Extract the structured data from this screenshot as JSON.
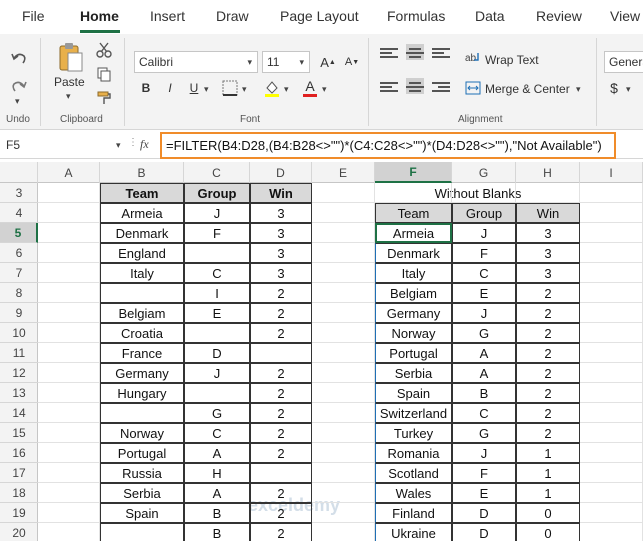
{
  "menu": {
    "tabs": [
      "File",
      "Home",
      "Insert",
      "Draw",
      "Page Layout",
      "Formulas",
      "Data",
      "Review",
      "View"
    ],
    "active": "Home"
  },
  "ribbon": {
    "paste_label": "Paste",
    "groups": {
      "undo": "Undo",
      "clipboard": "Clipboard",
      "font": "Font",
      "alignment": "Alignment"
    },
    "font_name": "Calibri",
    "font_size": "11",
    "bold": "B",
    "italic": "I",
    "underline": "U",
    "font_color_letter": "A",
    "wrap_text": "Wrap Text",
    "merge_center": "Merge & Center",
    "number_format": "Genera",
    "currency": "$",
    "accent_color": "#1e7145",
    "highlight_color": "#f08c2a"
  },
  "formula_bar": {
    "name_box": "F5",
    "fx": "fx",
    "formula": "=FILTER(B4:D28,(B4:B28<>\"\")*(C4:C28<>\"\")*(D4:D28<>\"\"),\"Not Available\")"
  },
  "columns": [
    "A",
    "B",
    "C",
    "D",
    "E",
    "F",
    "G",
    "H",
    "I"
  ],
  "selected_column": "F",
  "rows": [
    3,
    4,
    5,
    6,
    7,
    8,
    9,
    10,
    11,
    12,
    13,
    14,
    15,
    16,
    17,
    18,
    19,
    20
  ],
  "selected_row": 5,
  "source_table": {
    "headers": [
      "Team",
      "Group",
      "Win"
    ],
    "rows": [
      [
        "Armeia",
        "J",
        "3"
      ],
      [
        "Denmark",
        "F",
        "3"
      ],
      [
        "England",
        "",
        "3"
      ],
      [
        "Italy",
        "C",
        "3"
      ],
      [
        "",
        "I",
        "2"
      ],
      [
        "Belgiam",
        "E",
        "2"
      ],
      [
        "Croatia",
        "",
        "2"
      ],
      [
        "France",
        "D",
        ""
      ],
      [
        "Germany",
        "J",
        "2"
      ],
      [
        "Hungary",
        "",
        "2"
      ],
      [
        "",
        "G",
        "2"
      ],
      [
        "Norway",
        "C",
        "2"
      ],
      [
        "Portugal",
        "A",
        "2"
      ],
      [
        "Russia",
        "H",
        ""
      ],
      [
        "Serbia",
        "A",
        "2"
      ],
      [
        "Spain",
        "B",
        "2"
      ],
      [
        "",
        "B",
        "2"
      ]
    ]
  },
  "result_table": {
    "title": "Without Blanks",
    "headers": [
      "Team",
      "Group",
      "Win"
    ],
    "rows": [
      [
        "Armeia",
        "J",
        "3"
      ],
      [
        "Denmark",
        "F",
        "3"
      ],
      [
        "Italy",
        "C",
        "3"
      ],
      [
        "Belgiam",
        "E",
        "2"
      ],
      [
        "Germany",
        "J",
        "2"
      ],
      [
        "Norway",
        "G",
        "2"
      ],
      [
        "Portugal",
        "A",
        "2"
      ],
      [
        "Serbia",
        "A",
        "2"
      ],
      [
        "Spain",
        "B",
        "2"
      ],
      [
        "Switzerland",
        "C",
        "2"
      ],
      [
        "Turkey",
        "G",
        "2"
      ],
      [
        "Romania",
        "J",
        "1"
      ],
      [
        "Scotland",
        "F",
        "1"
      ],
      [
        "Wales",
        "E",
        "1"
      ],
      [
        "Finland",
        "D",
        "0"
      ],
      [
        "Ukraine",
        "D",
        "0"
      ]
    ]
  },
  "watermark": "exceldemy"
}
